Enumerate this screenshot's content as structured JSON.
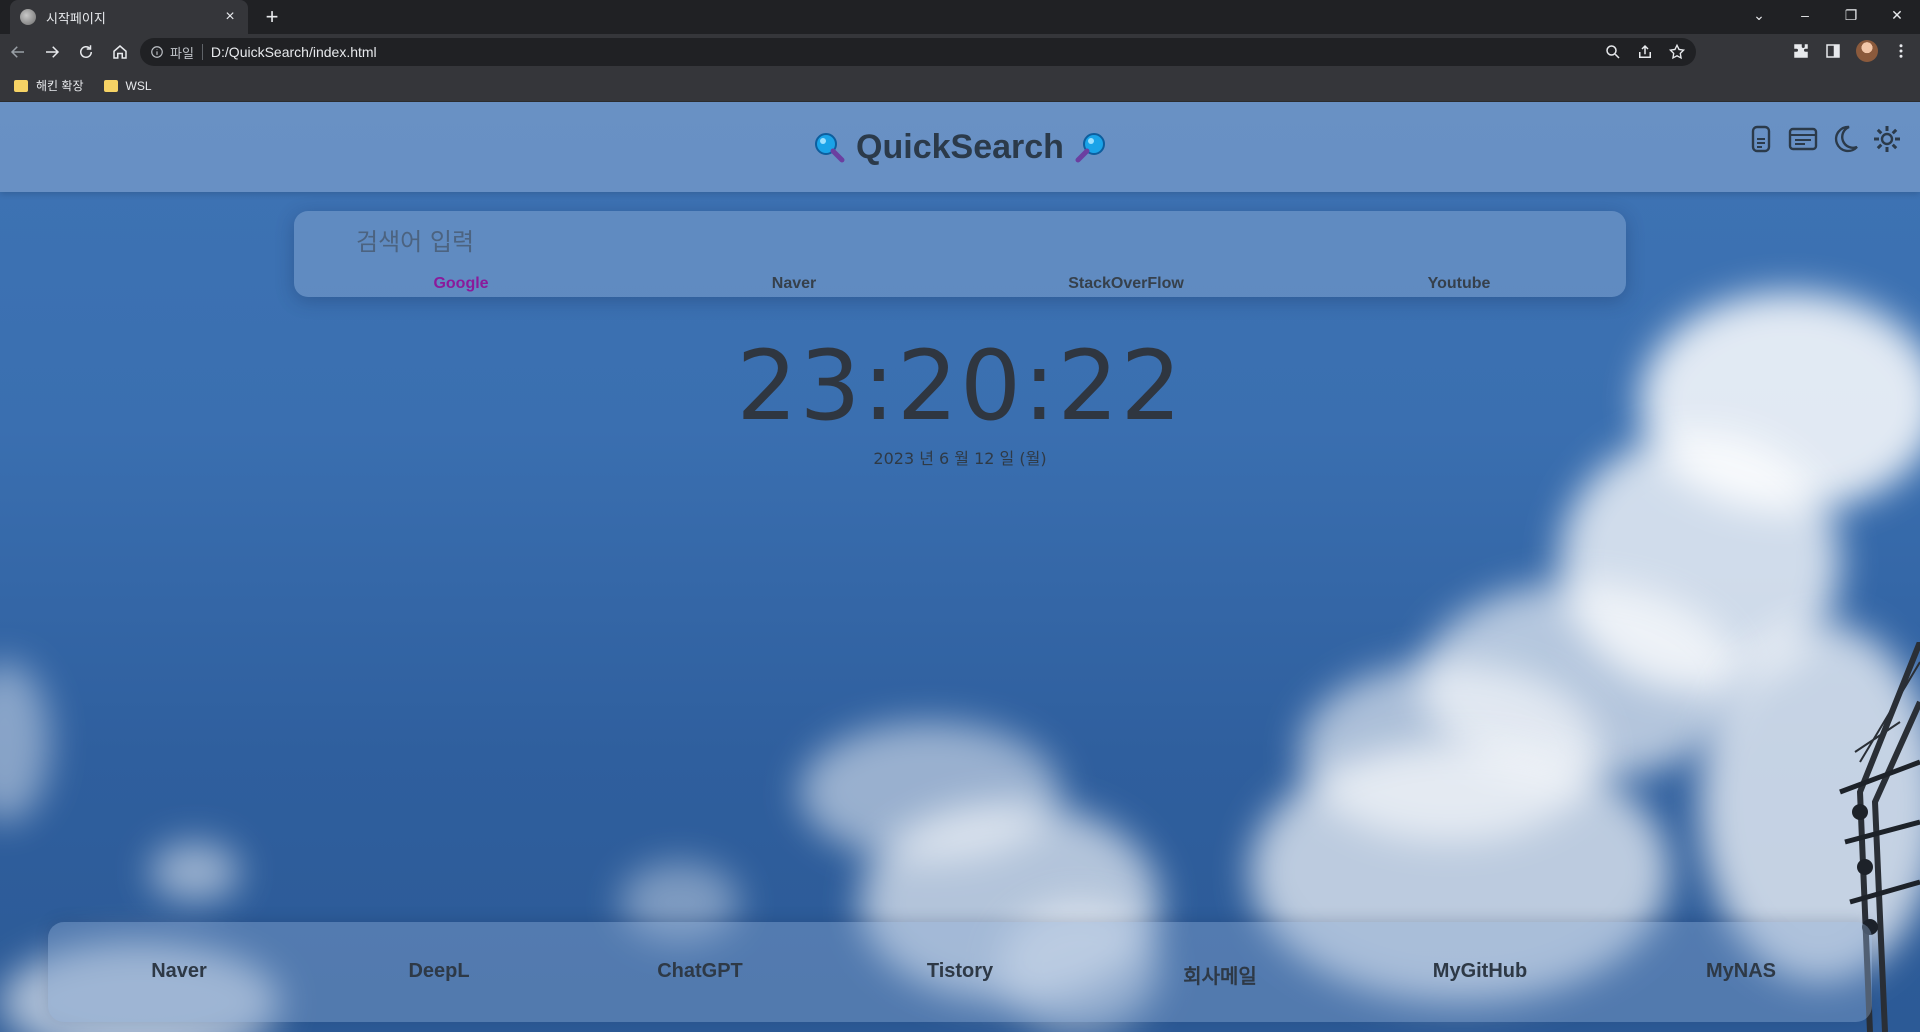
{
  "browser": {
    "tab_title": "시작페이지",
    "tab_close": "×",
    "new_tab": "+",
    "omnibox_prefix": "파일",
    "url": "D:/QuickSearch/index.html",
    "bookmarks": [
      {
        "label": "해킨 확장"
      },
      {
        "label": "WSL"
      }
    ],
    "window_controls": {
      "chevron": "⌄",
      "minimize": "–",
      "restore": "❐",
      "close": "✕"
    }
  },
  "header": {
    "title": "QuickSearch",
    "icons": [
      "memo-icon",
      "layout-icon",
      "moon-icon",
      "gear-icon"
    ]
  },
  "search": {
    "placeholder": "검색어 입력",
    "engines": [
      {
        "label": "Google",
        "active": true
      },
      {
        "label": "Naver",
        "active": false
      },
      {
        "label": "StackOverFlow",
        "active": false
      },
      {
        "label": "Youtube",
        "active": false
      }
    ],
    "active_color": "#8b1a9b"
  },
  "clock": {
    "time": "23:20:22",
    "date": "2023 년 6 월 12 일 (월)"
  },
  "dock": {
    "links": [
      {
        "label": "Naver"
      },
      {
        "label": "DeepL"
      },
      {
        "label": "ChatGPT"
      },
      {
        "label": "Tistory"
      },
      {
        "label": "회사메일"
      },
      {
        "label": "MyGitHub"
      },
      {
        "label": "MyNAS"
      }
    ]
  }
}
